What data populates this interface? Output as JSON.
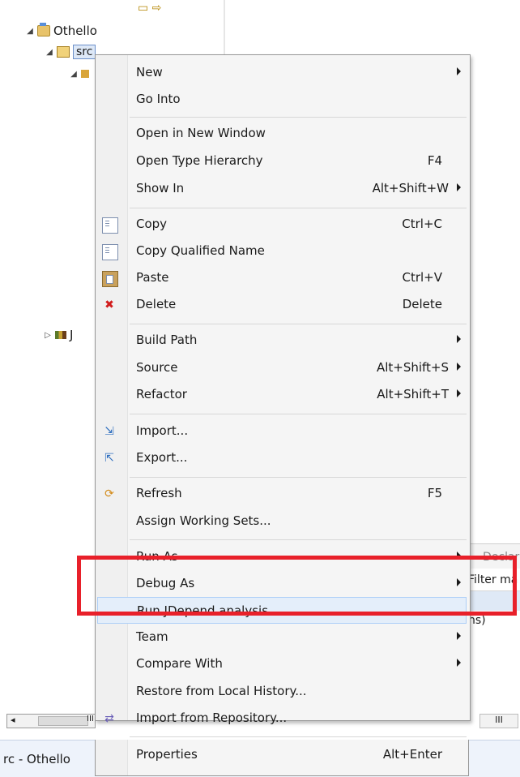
{
  "explorer": {
    "project_name": "Othello",
    "src_label": "src",
    "package_glyph": "#",
    "library_letter": "J"
  },
  "right_panel": {
    "tab_partial": "Declara",
    "filter_partial": "Filter ma",
    "row_partial": "ns)"
  },
  "statusbar": {
    "text": "rc - Othello"
  },
  "scroll_marks": {
    "left_grip": "III",
    "right_grip": "III"
  },
  "menu": {
    "items": [
      {
        "label": "New",
        "shortcut": "",
        "submenu": true
      },
      {
        "label": "Go Into",
        "shortcut": "",
        "submenu": false
      },
      {
        "label": "Open in New Window",
        "shortcut": "",
        "submenu": false
      },
      {
        "label": "Open Type Hierarchy",
        "shortcut": "F4",
        "submenu": false
      },
      {
        "label": "Show In",
        "shortcut": "Alt+Shift+W",
        "submenu": true
      },
      {
        "label": "Copy",
        "shortcut": "Ctrl+C",
        "submenu": false,
        "icon": "copy-icon"
      },
      {
        "label": "Copy Qualified Name",
        "shortcut": "",
        "submenu": false,
        "icon": "copy-qualified-icon"
      },
      {
        "label": "Paste",
        "shortcut": "Ctrl+V",
        "submenu": false,
        "icon": "paste-icon"
      },
      {
        "label": "Delete",
        "shortcut": "Delete",
        "submenu": false,
        "icon": "delete-icon"
      },
      {
        "label": "Build Path",
        "shortcut": "",
        "submenu": true
      },
      {
        "label": "Source",
        "shortcut": "Alt+Shift+S",
        "submenu": true
      },
      {
        "label": "Refactor",
        "shortcut": "Alt+Shift+T",
        "submenu": true
      },
      {
        "label": "Import...",
        "shortcut": "",
        "submenu": false,
        "icon": "import-icon"
      },
      {
        "label": "Export...",
        "shortcut": "",
        "submenu": false,
        "icon": "export-icon"
      },
      {
        "label": "Refresh",
        "shortcut": "F5",
        "submenu": false,
        "icon": "refresh-icon"
      },
      {
        "label": "Assign Working Sets...",
        "shortcut": "",
        "submenu": false
      },
      {
        "label": "Run As",
        "shortcut": "",
        "submenu": true
      },
      {
        "label": "Debug As",
        "shortcut": "",
        "submenu": true
      },
      {
        "label": "Run JDepend analysis",
        "shortcut": "",
        "submenu": false,
        "highlighted": true
      },
      {
        "label": "Team",
        "shortcut": "",
        "submenu": true
      },
      {
        "label": "Compare With",
        "shortcut": "",
        "submenu": true
      },
      {
        "label": "Restore from Local History...",
        "shortcut": "",
        "submenu": false
      },
      {
        "label": "Import from Repository...",
        "shortcut": "",
        "submenu": false,
        "icon": "repository-icon"
      },
      {
        "label": "Properties",
        "shortcut": "Alt+Enter",
        "submenu": false
      }
    ]
  },
  "colors": {
    "annotation": "#e8202a",
    "highlight_bg": "#e4eefa",
    "menu_bg": "#f5f5f5"
  }
}
